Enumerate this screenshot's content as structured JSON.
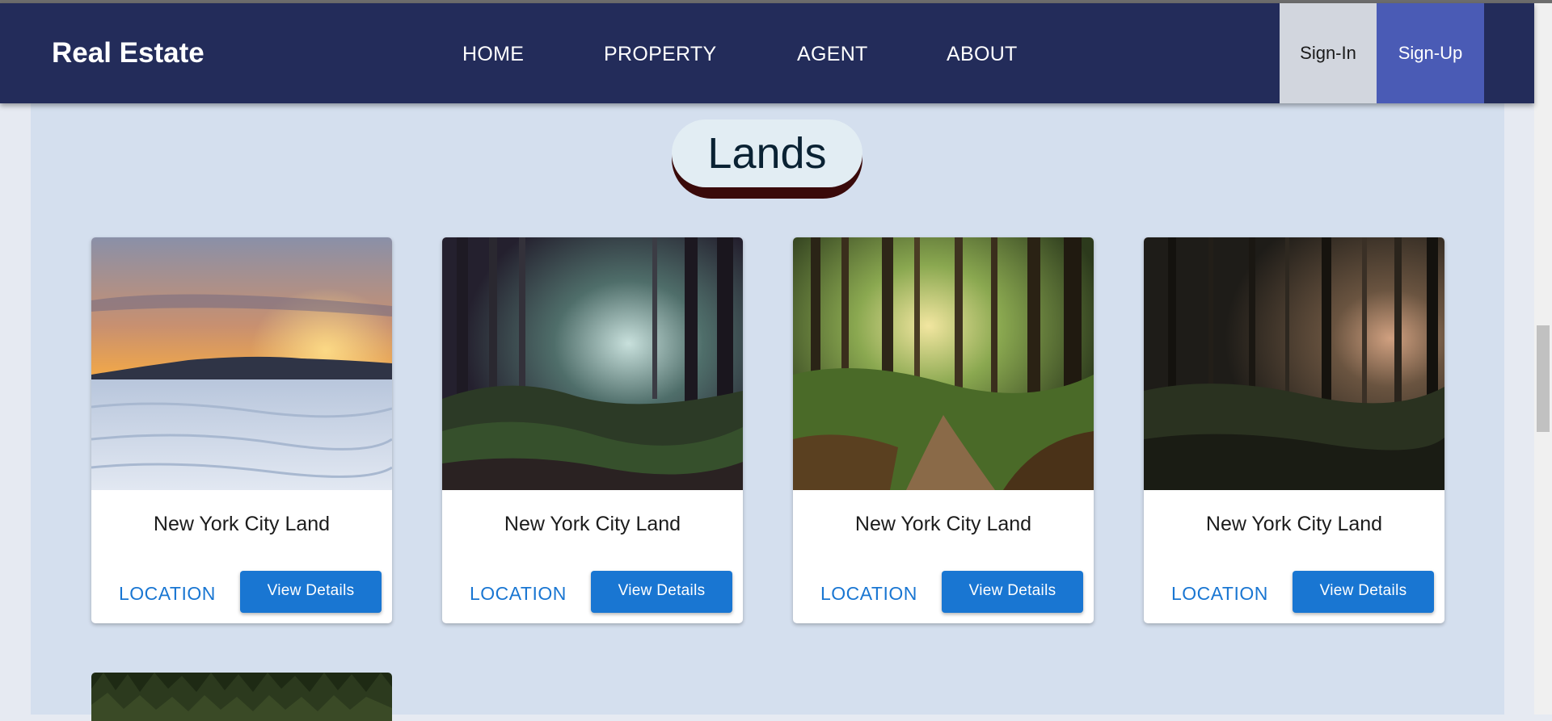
{
  "brand": "Real Estate",
  "nav": {
    "items": [
      "HOME",
      "PROPERTY",
      "AGENT",
      "ABOUT"
    ],
    "signin": "Sign-In",
    "signup": "Sign-Up"
  },
  "section": {
    "title": "Lands"
  },
  "cards": [
    {
      "title": "New York City Land",
      "location": "LOCATION",
      "button": "View Details",
      "image": "snowy-lake-sunset"
    },
    {
      "title": "New York City Land",
      "location": "LOCATION",
      "button": "View Details",
      "image": "misty-forest"
    },
    {
      "title": "New York City Land",
      "location": "LOCATION",
      "button": "View Details",
      "image": "forest-path"
    },
    {
      "title": "New York City Land",
      "location": "LOCATION",
      "button": "View Details",
      "image": "dark-forest"
    }
  ],
  "colors": {
    "navbar": "#232c5a",
    "signin_bg": "#d2d6de",
    "signup_bg": "#4a5bb5",
    "section_bg": "#d4dfee",
    "accent": "#1976d2"
  }
}
